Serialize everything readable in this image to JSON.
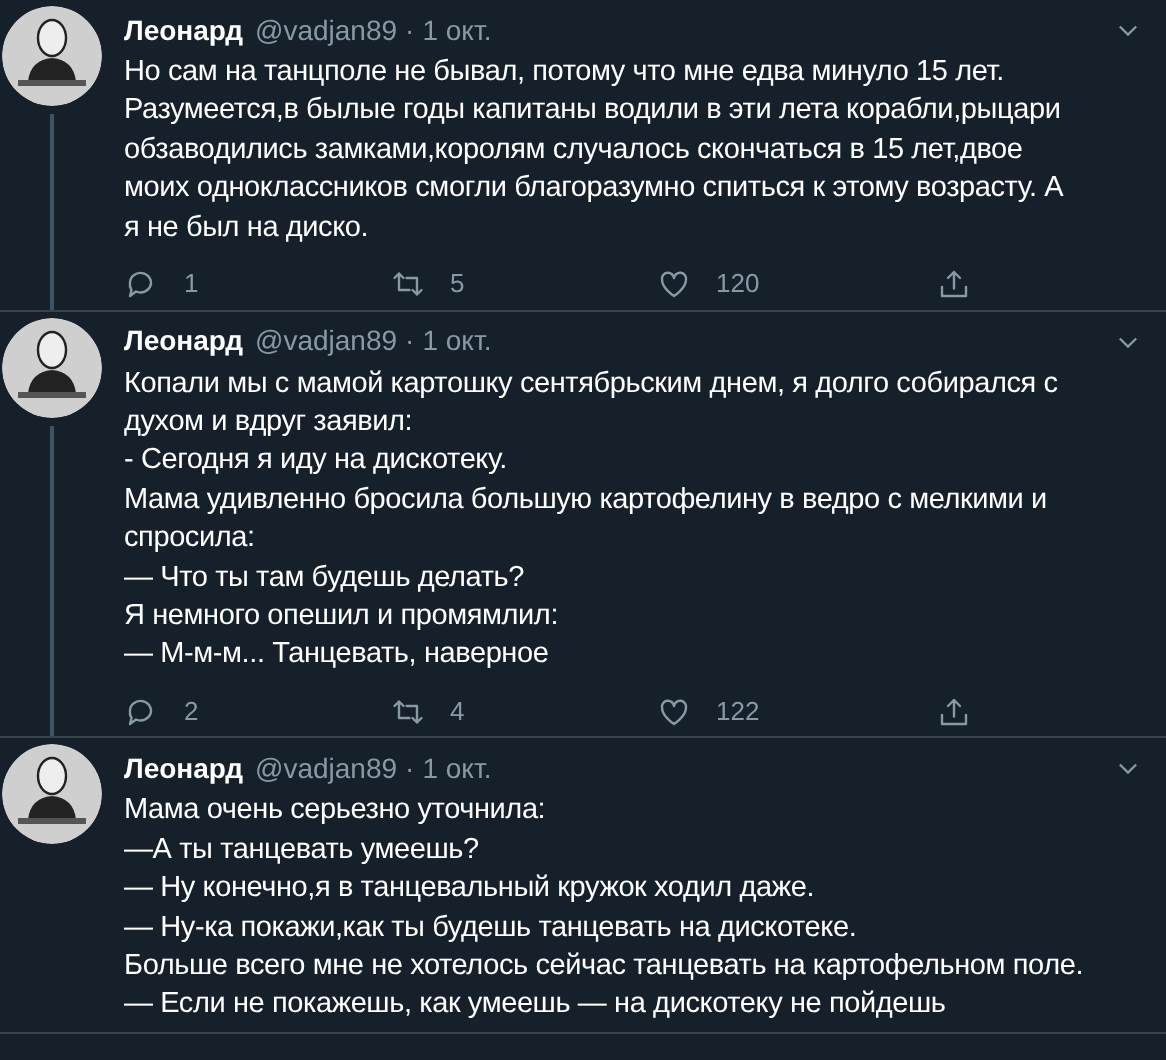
{
  "tweets": [
    {
      "name": "Леонард",
      "handle": "@vadjan89",
      "separator": "·",
      "date": "1 окт.",
      "thread": true,
      "body": "Но сам на танцполе не бывал, потому что мне едва минуло 15 лет.\nРазумеется,в былые годы капитаны водили в эти лета корабли,рыцари\nобзаводились замками,королям случалось скончаться в 15 лет,двое\nмоих одноклассников смогли благоразумно спиться к этому возрасту. А\nя не был на диско.",
      "replies": "1",
      "retweets": "5",
      "likes": "120"
    },
    {
      "name": "Леонард",
      "handle": "@vadjan89",
      "separator": "·",
      "date": "1 окт.",
      "thread": true,
      "body": "Копали мы с мамой картошку сентябрьским днем, я долго собирался с\nдухом и вдруг заявил:\n- Сегодня я иду на дискотеку.\nМама удивленно бросила большую картофелину в ведро с мелкими и\nспросила:\n— Что ты там будешь делать?\nЯ немного опешил и промямлил:\n— М-м-м... Танцевать, наверное",
      "replies": "2",
      "retweets": "4",
      "likes": "122"
    },
    {
      "name": "Леонард",
      "handle": "@vadjan89",
      "separator": "·",
      "date": "1 окт.",
      "body": "Мама очень серьезно уточнила:\n—А ты танцевать умеешь?\n— Ну конечно,я в танцевальный кружок ходил даже.\n— Ну-ка покажи,как ты будешь танцевать на дискотеке.\nБольше всего мне не хотелось сейчас танцевать на картофельном поле.\n— Если не покажешь, как умеешь — на дискотеку не пойдешь"
    }
  ]
}
